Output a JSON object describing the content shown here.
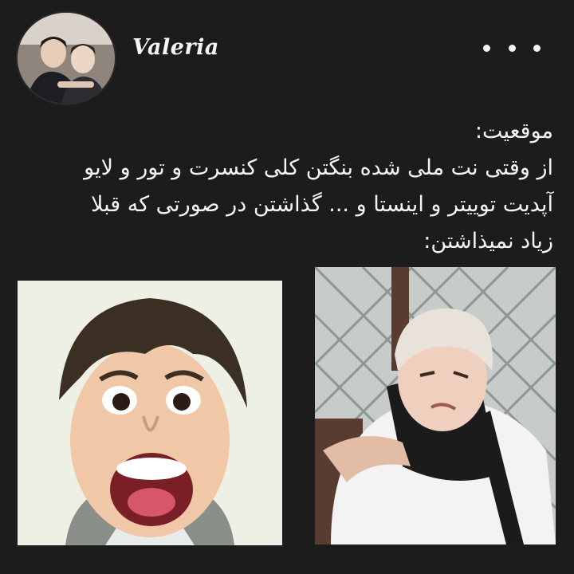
{
  "profile": {
    "username": "Valeria",
    "avatar_icon": "profile-photo"
  },
  "menu": {
    "icon": "more-options-icon"
  },
  "post": {
    "lines": [
      "موقعیت:",
      "از وقتی نت ملی شده بنگتن کلی کنسرت و تور و لایو",
      "آپدیت توییتر و اینستا و ... گذاشتن در صورتی که قبلا",
      "زیاد نمیذاشتن:"
    ]
  },
  "images": [
    {
      "icon": "shocked-face-photo"
    },
    {
      "icon": "grimace-face-photo"
    }
  ],
  "colors": {
    "background": "#1c1c1c",
    "text": "#f5f5f5"
  }
}
